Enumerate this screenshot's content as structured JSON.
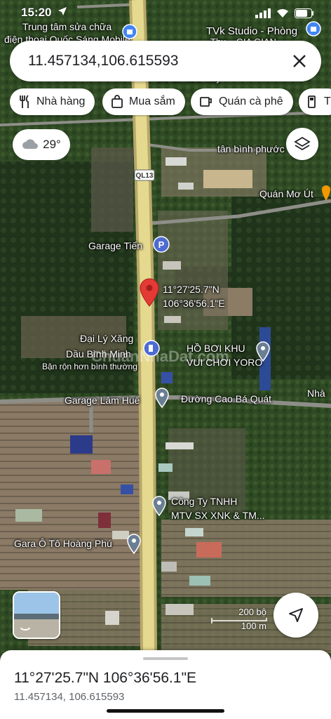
{
  "status_bar": {
    "time": "15:20"
  },
  "search": {
    "query": "11.457134,106.615593"
  },
  "chips": [
    {
      "label": "Nhà hàng",
      "icon": "fork-knife-icon"
    },
    {
      "label": "Mua sắm",
      "icon": "shopping-bag-icon"
    },
    {
      "label": "Quán cà phê",
      "icon": "coffee-cup-icon"
    },
    {
      "label": "T",
      "icon": "gas-pump-icon"
    }
  ],
  "weather": {
    "temperature": "29°",
    "icon": "cloud-icon"
  },
  "map": {
    "road_shield": "QL13",
    "pin": {
      "lat_label": "11°27'25.7\"N",
      "lng_label": "106°36'56.1\"E"
    },
    "places": [
      {
        "name": "Trung tâm sửa chữa"
      },
      {
        "name": "điện thoại Quốc Sáng Mobile"
      },
      {
        "name": "TVk Studio - Phòng"
      },
      {
        "name": "Thu... GIA GIAN"
      },
      {
        "name": "Cơ sở sửa máy"
      },
      {
        "name": "tân bình phước"
      },
      {
        "name": "Quán Mơ Út"
      },
      {
        "name": "Garage Tiến"
      },
      {
        "name": "Đại Lý Xăng"
      },
      {
        "name": "Dầu Bình Minh"
      },
      {
        "name": "Bận rộn hơn bình thường"
      },
      {
        "name": "HỒ BƠI KHU"
      },
      {
        "name": "VUI CHƠI YORO"
      },
      {
        "name": "Nhà"
      },
      {
        "name": "Garage Lâm Huế"
      },
      {
        "name": "Đường Cao Bá Quát"
      },
      {
        "name": "Công Ty TNHH"
      },
      {
        "name": "MTV SX XNK & TM..."
      },
      {
        "name": "Gara Ô Tô Hoàng Phú"
      }
    ],
    "watermark": "ChuanNhaDat.com"
  },
  "scale": {
    "feet": "200 bộ",
    "meters": "100 m"
  },
  "sheet": {
    "title": "11°27'25.7\"N 106°36'56.1\"E",
    "subtitle": "11.457134, 106.615593"
  }
}
